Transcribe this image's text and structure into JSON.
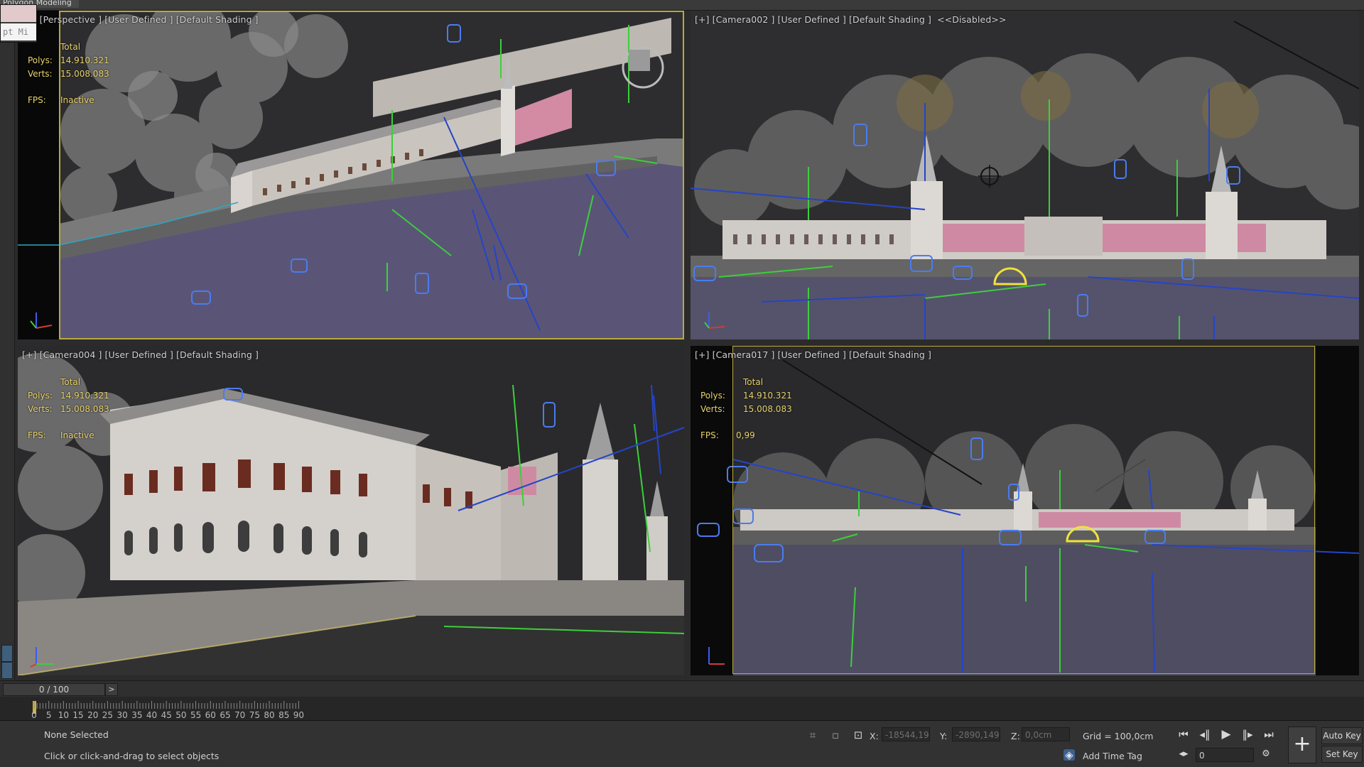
{
  "app": {
    "mode_label": "Polygon Modeling"
  },
  "viewports": [
    {
      "label": "[+] [Perspective ] [User Defined ] [Default Shading ]",
      "stats": {
        "total_label": "Total",
        "polys_label": "Polys:",
        "polys": "14.910.321",
        "verts_label": "Verts:",
        "verts": "15.008.083",
        "fps_label": "FPS:",
        "fps": "Inactive"
      }
    },
    {
      "label": "[+] [Camera002 ] [User Defined ] [Default Shading ]  <<Disabled>>"
    },
    {
      "label": "[+] [Camera004 ] [User Defined ] [Default Shading ]",
      "stats": {
        "total_label": "Total",
        "polys_label": "Polys:",
        "polys": "14.910.321",
        "verts_label": "Verts:",
        "verts": "15.008.083",
        "fps_label": "FPS:",
        "fps": "Inactive"
      }
    },
    {
      "label": "[+] [Camera017 ] [User Defined ] [Default Shading ]",
      "stats": {
        "total_label": "Total",
        "polys_label": "Polys:",
        "polys": "14.910.321",
        "verts_label": "Verts:",
        "verts": "15.008.083",
        "fps_label": "FPS:",
        "fps": "0,99"
      }
    }
  ],
  "timeline": {
    "position": "0 / 100",
    "next": ">",
    "ticks": [
      "0",
      "5",
      "10",
      "15",
      "20",
      "25",
      "30",
      "35",
      "40",
      "45",
      "50",
      "55",
      "60",
      "65",
      "70",
      "75",
      "80",
      "85",
      "90"
    ]
  },
  "status": {
    "selection": "None Selected",
    "prompt": "Click or click-and-drag to select objects",
    "maxscript_text": "pt Mi",
    "x_label": "X:",
    "x_value": "-18544,19",
    "y_label": "Y:",
    "y_value": "-2890,149",
    "z_label": "Z:",
    "z_value": "0,0cm",
    "grid": "Grid = 100,0cm",
    "add_time_tag": "Add Time Tag",
    "frame_value": "0",
    "auto_key": "Auto Key",
    "set_key": "Set Key"
  },
  "icons": [
    "isolate-icon",
    "lock-icon",
    "transform-type-in-icon",
    "go-to-start-icon",
    "prev-frame-icon",
    "play-icon",
    "next-frame-icon",
    "go-to-end-icon",
    "key-mode-icon",
    "time-config-icon",
    "set-keys-icon",
    "add-time-tag-icon"
  ],
  "colors": {
    "selection_frame": "#b9a93e",
    "stats_text": "#e9d36b",
    "camera_blue": "#3f6fe0",
    "helper_green": "#3ccf3c"
  }
}
